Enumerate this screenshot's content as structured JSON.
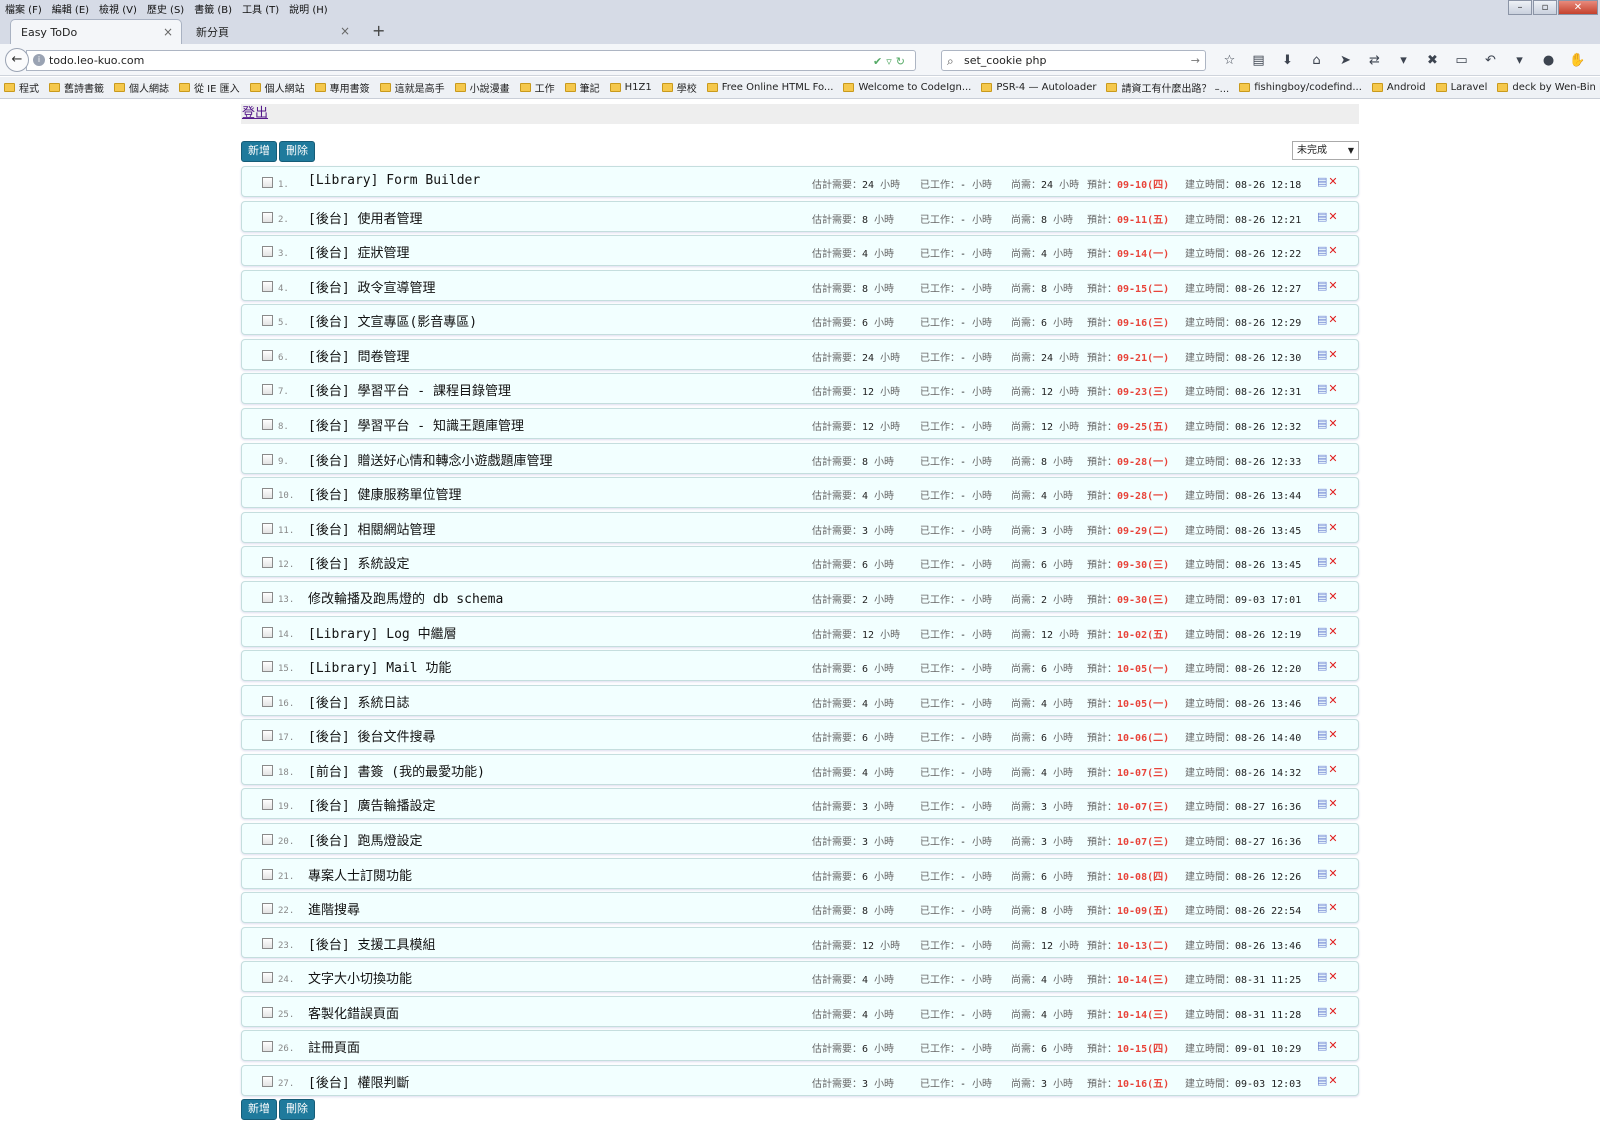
{
  "browser": {
    "menu": [
      "檔案 (F)",
      "編輯 (E)",
      "檢視 (V)",
      "歷史 (S)",
      "書籤 (B)",
      "工具 (T)",
      "說明 (H)"
    ],
    "tabs": [
      {
        "label": "Easy ToDo",
        "active": true
      },
      {
        "label": "新分頁",
        "active": false
      }
    ],
    "url": "todo.leo-kuo.com",
    "search": "set_cookie php",
    "bookmarks": [
      "程式",
      "舊詩書籤",
      "個人網誌",
      "從 IE 匯入",
      "個人網站",
      "專用書簽",
      "這就是高手",
      "小說漫畫",
      "工作",
      "筆記",
      "H1Z1",
      "學校",
      "Free Online HTML Fo...",
      "Welcome to CodeIgn...",
      "PSR-4 — Autoloader",
      "請資工有什麼出路？ –...",
      "fishingboy/codefind...",
      "Android",
      "Laravel",
      "deck by Wen-Bin Kuo"
    ]
  },
  "page": {
    "logout_label": "登出",
    "add_label": "新增",
    "delete_label": "刪除",
    "filter_value": "未完成",
    "labels": {
      "estimate": "估計需要：",
      "worked": "已工作：",
      "remaining": "尚需：",
      "due": "預計：",
      "created": "建立時間：",
      "hours": "小時",
      "dash": "-"
    }
  },
  "todos": [
    {
      "no": "1.",
      "title": "[Library] Form Builder",
      "est": "24",
      "rem": "24",
      "due": "09-10(四)",
      "created": "08-26 12:18"
    },
    {
      "no": "2.",
      "title": "[後台] 使用者管理",
      "est": "8",
      "rem": "8",
      "due": "09-11(五)",
      "created": "08-26 12:21"
    },
    {
      "no": "3.",
      "title": "[後台] 症狀管理",
      "est": "4",
      "rem": "4",
      "due": "09-14(一)",
      "created": "08-26 12:22"
    },
    {
      "no": "4.",
      "title": "[後台] 政令宣導管理",
      "est": "8",
      "rem": "8",
      "due": "09-15(二)",
      "created": "08-26 12:27"
    },
    {
      "no": "5.",
      "title": "[後台] 文宣專區(影音專區)",
      "est": "6",
      "rem": "6",
      "due": "09-16(三)",
      "created": "08-26 12:29"
    },
    {
      "no": "6.",
      "title": "[後台] 問卷管理",
      "est": "24",
      "rem": "24",
      "due": "09-21(一)",
      "created": "08-26 12:30"
    },
    {
      "no": "7.",
      "title": "[後台] 學習平台 - 課程目錄管理",
      "est": "12",
      "rem": "12",
      "due": "09-23(三)",
      "created": "08-26 12:31"
    },
    {
      "no": "8.",
      "title": "[後台] 學習平台 - 知識王題庫管理",
      "est": "12",
      "rem": "12",
      "due": "09-25(五)",
      "created": "08-26 12:32"
    },
    {
      "no": "9.",
      "title": "[後台] 贈送好心情和轉念小遊戲題庫管理",
      "est": "8",
      "rem": "8",
      "due": "09-28(一)",
      "created": "08-26 12:33"
    },
    {
      "no": "10.",
      "title": "[後台] 健康服務單位管理",
      "est": "4",
      "rem": "4",
      "due": "09-28(一)",
      "created": "08-26 13:44"
    },
    {
      "no": "11.",
      "title": "[後台] 相關網站管理",
      "est": "3",
      "rem": "3",
      "due": "09-29(二)",
      "created": "08-26 13:45"
    },
    {
      "no": "12.",
      "title": "[後台] 系統設定",
      "est": "6",
      "rem": "6",
      "due": "09-30(三)",
      "created": "08-26 13:45"
    },
    {
      "no": "13.",
      "title": "修改輪播及跑馬燈的 db schema",
      "est": "2",
      "rem": "2",
      "due": "09-30(三)",
      "created": "09-03 17:01"
    },
    {
      "no": "14.",
      "title": "[Library] Log 中繼層",
      "est": "12",
      "rem": "12",
      "due": "10-02(五)",
      "created": "08-26 12:19"
    },
    {
      "no": "15.",
      "title": "[Library] Mail 功能",
      "est": "6",
      "rem": "6",
      "due": "10-05(一)",
      "created": "08-26 12:20"
    },
    {
      "no": "16.",
      "title": "[後台] 系統日誌",
      "est": "4",
      "rem": "4",
      "due": "10-05(一)",
      "created": "08-26 13:46"
    },
    {
      "no": "17.",
      "title": "[後台] 後台文件搜尋",
      "est": "6",
      "rem": "6",
      "due": "10-06(二)",
      "created": "08-26 14:40"
    },
    {
      "no": "18.",
      "title": "[前台] 書簽 (我的最愛功能)",
      "est": "4",
      "rem": "4",
      "due": "10-07(三)",
      "created": "08-26 14:32"
    },
    {
      "no": "19.",
      "title": "[後台] 廣告輪播設定",
      "est": "3",
      "rem": "3",
      "due": "10-07(三)",
      "created": "08-27 16:36"
    },
    {
      "no": "20.",
      "title": "[後台] 跑馬燈設定",
      "est": "3",
      "rem": "3",
      "due": "10-07(三)",
      "created": "08-27 16:36"
    },
    {
      "no": "21.",
      "title": "專案人士訂閱功能",
      "est": "6",
      "rem": "6",
      "due": "10-08(四)",
      "created": "08-26 12:26"
    },
    {
      "no": "22.",
      "title": "進階搜尋",
      "est": "8",
      "rem": "8",
      "due": "10-09(五)",
      "created": "08-26 22:54"
    },
    {
      "no": "23.",
      "title": "[後台] 支援工具模組",
      "est": "12",
      "rem": "12",
      "due": "10-13(二)",
      "created": "08-26 13:46"
    },
    {
      "no": "24.",
      "title": "文字大小切換功能",
      "est": "4",
      "rem": "4",
      "due": "10-14(三)",
      "created": "08-31 11:25"
    },
    {
      "no": "25.",
      "title": "客製化錯誤頁面",
      "est": "4",
      "rem": "4",
      "due": "10-14(三)",
      "created": "08-31 11:28"
    },
    {
      "no": "26.",
      "title": "註冊頁面",
      "est": "6",
      "rem": "6",
      "due": "10-15(四)",
      "created": "09-01 10:29"
    },
    {
      "no": "27.",
      "title": "[後台] 權限判斷",
      "est": "3",
      "rem": "3",
      "due": "10-16(五)",
      "created": "09-03 12:03"
    }
  ]
}
